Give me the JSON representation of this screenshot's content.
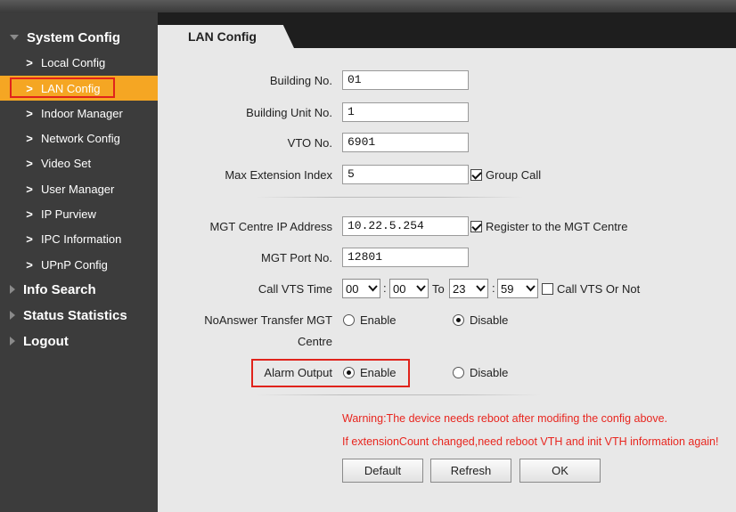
{
  "sidebar": {
    "groups": [
      {
        "label": "System Config"
      },
      {
        "label": "Info Search"
      },
      {
        "label": "Status Statistics"
      },
      {
        "label": "Logout"
      }
    ],
    "items": [
      {
        "label": "Local Config"
      },
      {
        "label": "LAN Config"
      },
      {
        "label": "Indoor Manager"
      },
      {
        "label": "Network Config"
      },
      {
        "label": "Video Set"
      },
      {
        "label": "User Manager"
      },
      {
        "label": "IP Purview"
      },
      {
        "label": "IPC Information"
      },
      {
        "label": "UPnP Config"
      }
    ],
    "chevron": ">"
  },
  "tab": {
    "label": "LAN Config"
  },
  "form": {
    "building_no": {
      "label": "Building No.",
      "value": "01"
    },
    "building_unit_no": {
      "label": "Building Unit No.",
      "value": "1"
    },
    "vto_no": {
      "label": "VTO No.",
      "value": "6901"
    },
    "max_ext_index": {
      "label": "Max Extension Index",
      "value": "5"
    },
    "group_call": {
      "label": "Group Call",
      "checked": true
    },
    "mgt_ip": {
      "label": "MGT Centre IP Address",
      "value": "10.22.5.254"
    },
    "register_mgt": {
      "label": "Register to the MGT Centre",
      "checked": true
    },
    "mgt_port": {
      "label": "MGT Port No.",
      "value": "12801"
    },
    "call_vts_time": {
      "label": "Call VTS Time",
      "from_hour": "00",
      "from_min": "00",
      "to_label": "To",
      "to_hour": "23",
      "to_min": "59",
      "colon": ":"
    },
    "call_vts_or_not": {
      "label": "Call VTS Or Not",
      "checked": false
    },
    "noanswer_transfer": {
      "label_line1": "NoAnswer Transfer MGT",
      "label_line2": "Centre",
      "enable": "Enable",
      "disable": "Disable",
      "selected": "Disable"
    },
    "alarm_output": {
      "label": "Alarm Output",
      "enable": "Enable",
      "disable": "Disable",
      "selected": "Enable"
    }
  },
  "warnings": {
    "line1": "Warning:The device needs reboot after modifing the config above.",
    "line2": "If extensionCount changed,need reboot VTH and init VTH information again!"
  },
  "buttons": {
    "default": "Default",
    "refresh": "Refresh",
    "ok": "OK"
  },
  "colors": {
    "accent": "#f5a623",
    "highlight": "#e0231c",
    "warning": "#e8261f",
    "sidebar": "#3c3c3c"
  }
}
